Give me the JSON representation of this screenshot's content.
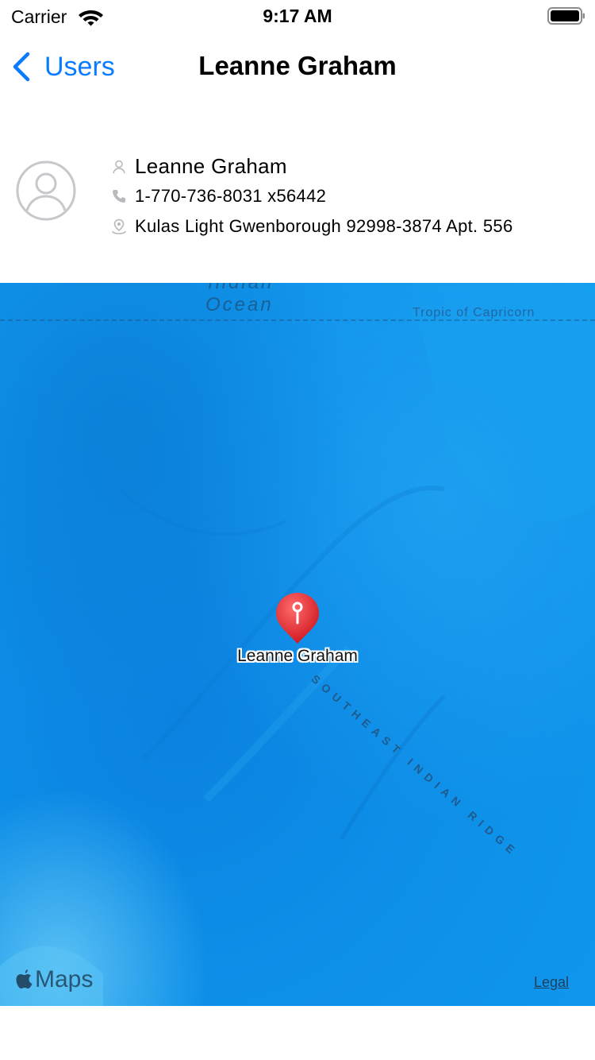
{
  "status_bar": {
    "carrier": "Carrier",
    "time": "9:17 AM",
    "icons": [
      "wifi-icon",
      "battery-icon"
    ]
  },
  "nav": {
    "back_label": "Users",
    "title": "Leanne Graham",
    "accent_color": "#0a7aff"
  },
  "profile": {
    "avatar_icon": "person-circle-icon",
    "name": "Leanne Graham",
    "phone": "1-770-736-8031 x56442",
    "address": "Kulas Light Gwenborough 92998-3874 Apt. 556",
    "icons": [
      "person-icon",
      "phone-icon",
      "location-pin-icon"
    ]
  },
  "map": {
    "ocean_label_partial": "Indian",
    "ocean_label": "Ocean",
    "tropic_label": "Tropic of Capricorn",
    "ridge_label": "SOUTHEAST INDIAN RIDGE",
    "pin_label": "Leanne Graham",
    "pin_color": "#e8262c",
    "water_color": "#0d8fe8",
    "brand": "Maps",
    "legal_label": "Legal"
  }
}
